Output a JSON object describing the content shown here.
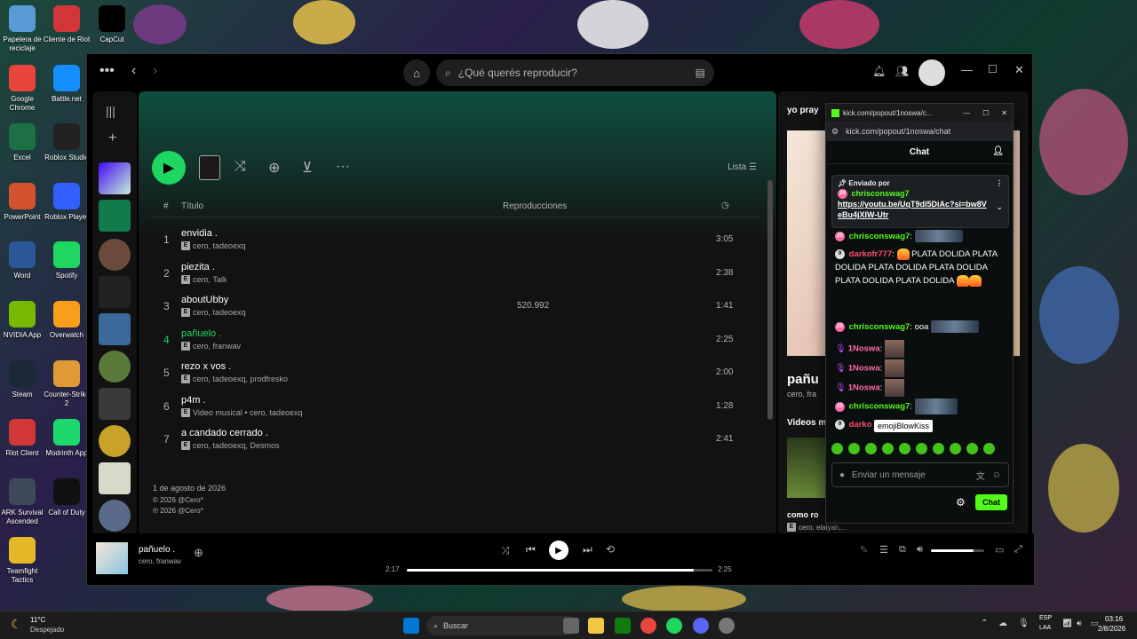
{
  "desktop": {
    "icons_col1": [
      {
        "label": "Papelera de reciclaje",
        "icon": "recycle-bin-icon",
        "color": "#5a9ad6"
      },
      {
        "label": "Google Chrome",
        "icon": "chrome-icon",
        "color": "#e8453c"
      },
      {
        "label": "Excel",
        "icon": "excel-icon",
        "color": "#1d7044"
      },
      {
        "label": "PowerPoint",
        "icon": "powerpoint-icon",
        "color": "#d35230"
      },
      {
        "label": "Word",
        "icon": "word-icon",
        "color": "#2b579a"
      },
      {
        "label": "NVIDIA App",
        "icon": "nvidia-icon",
        "color": "#76b900"
      },
      {
        "label": "Steam",
        "icon": "steam-icon",
        "color": "#1b2838"
      },
      {
        "label": "Riot Client",
        "icon": "riot-icon",
        "color": "#d13639"
      },
      {
        "label": "ARK Survival Ascended",
        "icon": "ark-icon",
        "color": "#3c4a5a"
      },
      {
        "label": "Teamfight Tactics",
        "icon": "tft-icon",
        "color": "#e5b82a"
      }
    ],
    "icons_col2": [
      {
        "label": "Cliente de Riot",
        "icon": "riot-icon",
        "color": "#d13639"
      },
      {
        "label": "Battle.net",
        "icon": "battlenet-icon",
        "color": "#148eff"
      },
      {
        "label": "Roblox Studio",
        "icon": "roblox-studio-icon",
        "color": "#222"
      },
      {
        "label": "Roblox Player",
        "icon": "roblox-icon",
        "color": "#335fff"
      },
      {
        "label": "Spotify",
        "icon": "spotify-icon",
        "color": "#1ed760"
      },
      {
        "label": "Overwatch",
        "icon": "overwatch-icon",
        "color": "#f99e1a"
      },
      {
        "label": "Counter-Strike 2",
        "icon": "cs2-icon",
        "color": "#de9b35"
      },
      {
        "label": "Modrinth App",
        "icon": "modrinth-icon",
        "color": "#1bd96a"
      },
      {
        "label": "Call of Duty",
        "icon": "cod-icon",
        "color": "#111"
      }
    ],
    "icons_col3": [
      {
        "label": "CapCut",
        "icon": "capcut-icon",
        "color": "#000"
      }
    ]
  },
  "spotify": {
    "search_placeholder": "¿Qué querés reproducir?",
    "list_label": "Lista",
    "table_headers": {
      "num": "#",
      "title": "Título",
      "plays": "Reproducciones"
    },
    "tracks": [
      {
        "num": "1",
        "title": "envidia .",
        "artist": "cero, tadeoexq",
        "plays": "",
        "duration": "3:05",
        "active": false
      },
      {
        "num": "2",
        "title": "piezita .",
        "artist": "cero, Talk",
        "plays": "",
        "duration": "2:38",
        "active": false
      },
      {
        "num": "3",
        "title": "aboutUbby",
        "artist": "cero, tadeoexq",
        "plays": "520.992",
        "duration": "1:41",
        "active": false
      },
      {
        "num": "4",
        "title": "pañuelo .",
        "artist": "cero, franwav",
        "plays": "",
        "duration": "2:25",
        "active": true
      },
      {
        "num": "5",
        "title": "rezo x vos .",
        "artist": "cero, tadeoexq, prodfresko",
        "plays": "",
        "duration": "2:00",
        "active": false
      },
      {
        "num": "6",
        "title": "p4m .",
        "artist": "Video musical • cero, tadeoexq",
        "plays": "",
        "duration": "1:28",
        "active": false
      },
      {
        "num": "7",
        "title": "a candado cerrado .",
        "artist": "cero, tadeoexq, Desmos",
        "plays": "",
        "duration": "2:41",
        "active": false
      }
    ],
    "release_date": "1 de agosto de 2026",
    "copyright_c": "© 2026 @Cero*",
    "copyright_p": "℗ 2026 @Cero*",
    "right_panel": {
      "title": "yo pray",
      "song_title": "pañu",
      "song_artist": "cero, fra",
      "videos_label": "Videos m",
      "related_title": "como ro",
      "related_artist": "cero, elaiyah,..."
    },
    "now_playing": {
      "title": "pañuelo .",
      "artist": "cero, franwav",
      "elapsed": "2:17",
      "total": "2:25",
      "progress": 0.94,
      "volume": 0.8
    }
  },
  "kick": {
    "window_title": "kick.com/popout/1noswa/c...",
    "url": "kick.com/popout/1noswa/chat",
    "chat_title": "Chat",
    "pinned": {
      "header": "Enviado por",
      "user": "chrisconswag7",
      "link": "https://youtu.be/UqT9dl5DiAc?si=bw8VeBu4jXIW-Utr"
    },
    "messages": [
      {
        "user": "chrisconswag7",
        "text": ""
      },
      {
        "user": "darkofr777",
        "text": "PLATA DOLIDA PLATA DOLIDA PLATA DOLIDA PLATA DOLIDA PLATA DOLIDA PLATA DOLIDA"
      },
      {
        "user": "chrisconswag7",
        "text": "ooa"
      },
      {
        "user": "1Noswa",
        "text": ""
      },
      {
        "user": "1Noswa",
        "text": ""
      },
      {
        "user": "1Noswa",
        "text": ""
      },
      {
        "user": "chrisconswag7",
        "text": ""
      },
      {
        "user": "darko",
        "text": ""
      }
    ],
    "tooltip": "emojiBlowKiss",
    "input_placeholder": "Enviar un mensaje",
    "send_label": "Chat"
  },
  "taskbar": {
    "weather_temp": "11°C",
    "weather_desc": "Despejado",
    "search_label": "Buscar",
    "lang_top": "ESP",
    "lang_bottom": "LAA",
    "time": "03:16",
    "date": "2/8/2026"
  }
}
